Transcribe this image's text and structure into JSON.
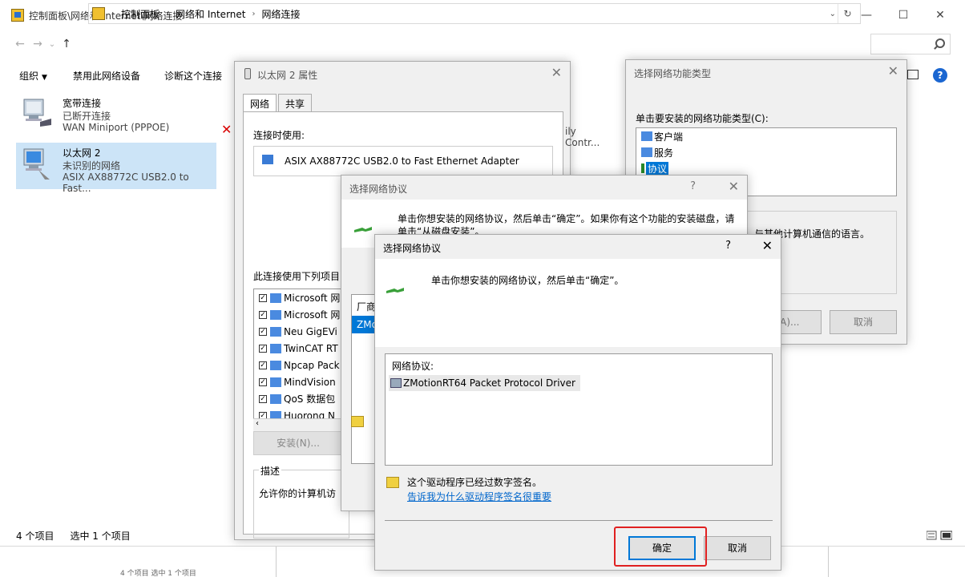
{
  "explorer": {
    "title": "控制面板\\网络和 Internet\\网络连接",
    "window_controls": {
      "minimize": "—",
      "maximize": "☐",
      "close": "✕"
    },
    "nav": {
      "back": "←",
      "forward": "→",
      "recent": "⌄",
      "up": "↑"
    },
    "breadcrumb": [
      "控制面板",
      "网络和 Internet",
      "网络连接"
    ],
    "commands": [
      {
        "label": "组织",
        "dropdown": true
      },
      {
        "label": "禁用此网络设备"
      },
      {
        "label": "诊断这个连接"
      }
    ],
    "help": "?",
    "connections": [
      {
        "name": "宽带连接",
        "status": "已断开连接",
        "device": "WAN Miniport (PPPOE)",
        "selected": false
      },
      {
        "name": "以太网 2",
        "status": "未识别的网络",
        "device": "ASIX AX88772C USB2.0 to Fast...",
        "selected": true
      }
    ],
    "status": {
      "count": "4 个项目",
      "selected": "选中 1 个项目"
    },
    "ghost_status": "4 个项目    选中 1 个项目"
  },
  "props": {
    "title": "以太网 2 属性",
    "tabs": [
      "网络",
      "共享"
    ],
    "connect_using_label": "连接时使用:",
    "adapter": "ASIX AX88772C USB2.0 to Fast Ethernet Adapter",
    "items_label": "此连接使用下列项目",
    "items": [
      "Microsoft 网",
      "Microsoft 网",
      "Neu GigEVi",
      "TwinCAT RT",
      "Npcap Pack",
      "MindVision",
      "QoS 数据包",
      "Huorong N"
    ],
    "install_label": "安装(N)...",
    "desc_legend": "描述",
    "desc_text": "允许你的计算机访",
    "bg_text": "ily Contr..."
  },
  "feature": {
    "title": "选择网络功能类型",
    "label": "单击要安装的网络功能类型(C):",
    "items": [
      {
        "label": "客户端",
        "selected": false
      },
      {
        "label": "服务",
        "selected": false
      },
      {
        "label": "协议",
        "selected": true
      }
    ],
    "desc": "与其他计算机通信的语言。",
    "add_label": "(A)...",
    "cancel_label": "取消"
  },
  "proto_back": {
    "title": "选择网络协议",
    "help": "?",
    "instruction": "单击你想安装的网络协议，然后单击“确定”。如果你有这个功能的安装磁盘，请单击“从磁盘安装”。",
    "mfr_header": "厂商",
    "mfr_selected": "ZMo"
  },
  "proto_front": {
    "title": "选择网络协议",
    "help": "?",
    "close": "✕",
    "instruction": "单击你想安装的网络协议，然后单击“确定”。",
    "list_header": "网络协议:",
    "protocol": "ZMotionRT64 Packet Protocol Driver",
    "signed_text": "这个驱动程序已经过数字签名。",
    "signed_link": "告诉我为什么驱动程序签名很重要",
    "ok_label": "确定",
    "cancel_label": "取消"
  }
}
